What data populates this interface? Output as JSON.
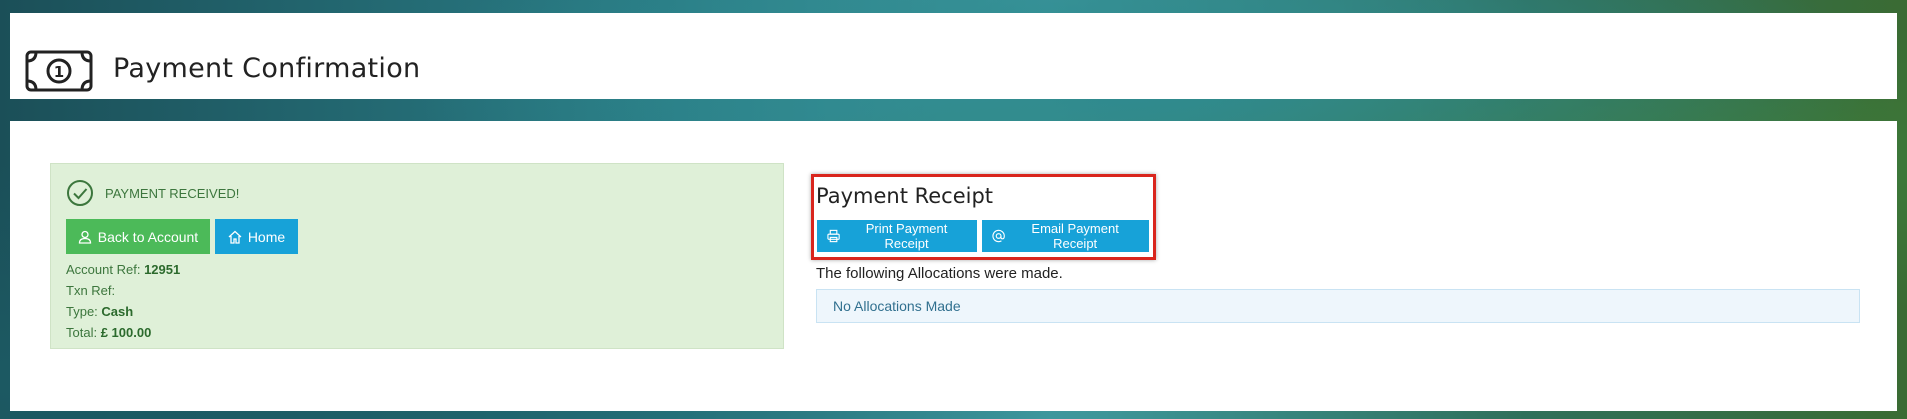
{
  "header": {
    "title": "Payment Confirmation",
    "icon": "money-bill-icon"
  },
  "payment": {
    "status_text": "PAYMENT RECEIVED!",
    "back_label": "Back to Account",
    "home_label": "Home",
    "account_ref_label": "Account Ref:",
    "account_ref_value": "12951",
    "txn_ref_label": "Txn Ref:",
    "txn_ref_value": "",
    "type_label": "Type:",
    "type_value": "Cash",
    "total_label": "Total:",
    "total_value": "£ 100.00"
  },
  "receipt": {
    "title": "Payment Receipt",
    "print_label": "Print Payment Receipt",
    "email_label": "Email Payment Receipt",
    "allocations_text": "The following Allocations were made.",
    "allocations_empty": "No Allocations Made"
  },
  "colors": {
    "success_bg": "#dff0d8",
    "success_text": "#3c763d",
    "green_button": "#4cba59",
    "blue_button": "#17a2d8",
    "highlight_border": "#d9251d"
  }
}
